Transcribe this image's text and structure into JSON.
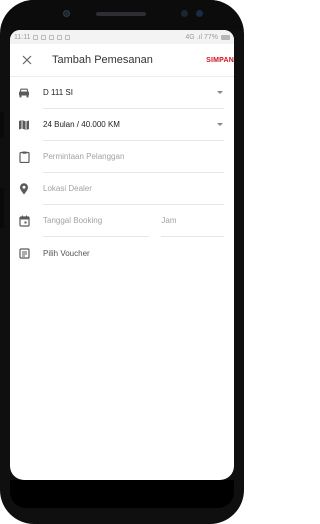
{
  "status_bar": {
    "time": "11:11",
    "right_text": "4G .ıl 77%"
  },
  "header": {
    "title": "Tambah Pemesanan",
    "save_label": "SIMPAN"
  },
  "form": {
    "vehicle": {
      "value": "D 111 SI",
      "icon": "car-icon"
    },
    "package": {
      "value": "24 Bulan / 40.000 KM",
      "icon": "map-icon"
    },
    "customer_request": {
      "placeholder": "Permintaan Pelanggan",
      "icon": "clipboard-icon"
    },
    "dealer_location": {
      "placeholder": "Lokasi Dealer",
      "icon": "location-pin-icon"
    },
    "booking_date": {
      "placeholder": "Tanggal Booking",
      "icon": "calendar-icon"
    },
    "booking_time": {
      "placeholder": "Jam"
    },
    "voucher": {
      "placeholder": "Pilih Voucher",
      "icon": "voucher-icon"
    }
  },
  "colors": {
    "accent": "#d0121b",
    "icon": "#5a5a5a",
    "placeholder": "#a3a3a3"
  }
}
